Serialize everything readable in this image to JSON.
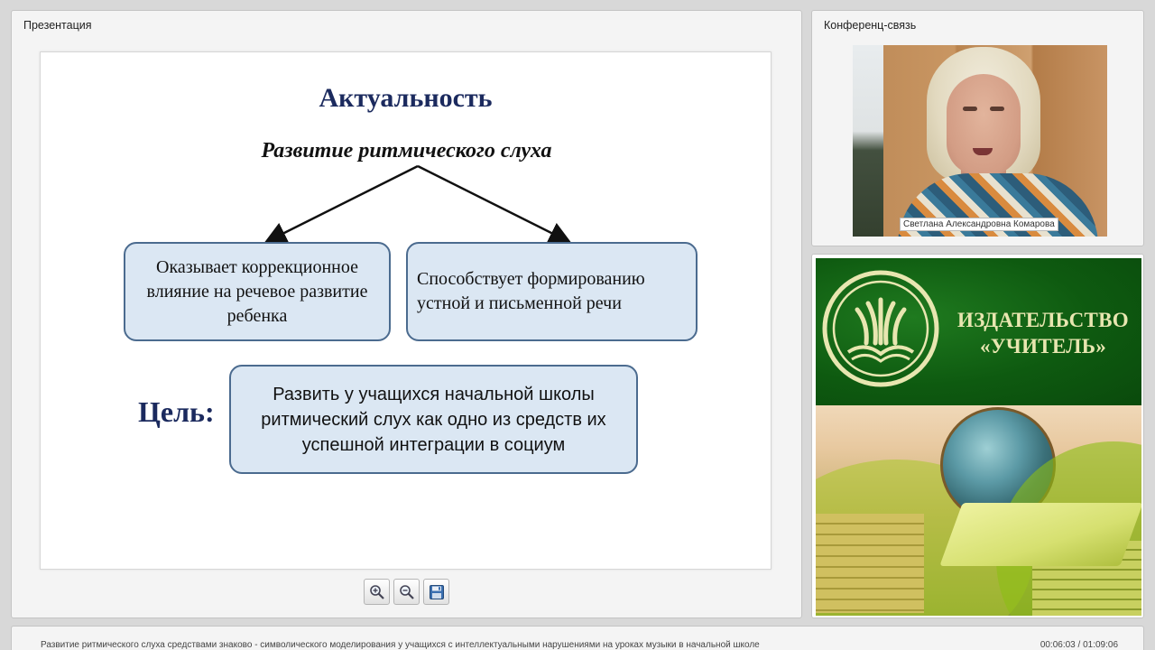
{
  "presentation": {
    "panel_title": "Презентация",
    "slide": {
      "title": "Актуальность",
      "subtitle": "Развитие ритмического слуха",
      "box_left": "Оказывает коррекционное влияние на речевое развитие ребенка",
      "box_right": "Способствует формированию устной и письменной речи",
      "goal_label": "Цель:",
      "goal_text": "Развить у учащихся   начальной школы ритмический слух как одно из средств их успешной интеграции в социум"
    },
    "toolbar": [
      "zoom-in-icon",
      "zoom-out-icon",
      "save-icon"
    ]
  },
  "conference": {
    "panel_title": "Конференц-связь",
    "participant_name": "Светлана Александровна Комарова"
  },
  "ad": {
    "name_line1": "ИЗДАТЕЛЬСТВО",
    "name_line2": "«УЧИТЕЛЬ»",
    "colors": {
      "green": "#0e5a10",
      "text": "#e8e6b0"
    }
  },
  "footer": {
    "title": "Развитие ритмического слуха средствами знаково - символического моделирования у учащихся с интеллектуальными нарушениями на уроках музыки в начальной школе",
    "time": "00:06:03 / 01:09:06"
  }
}
